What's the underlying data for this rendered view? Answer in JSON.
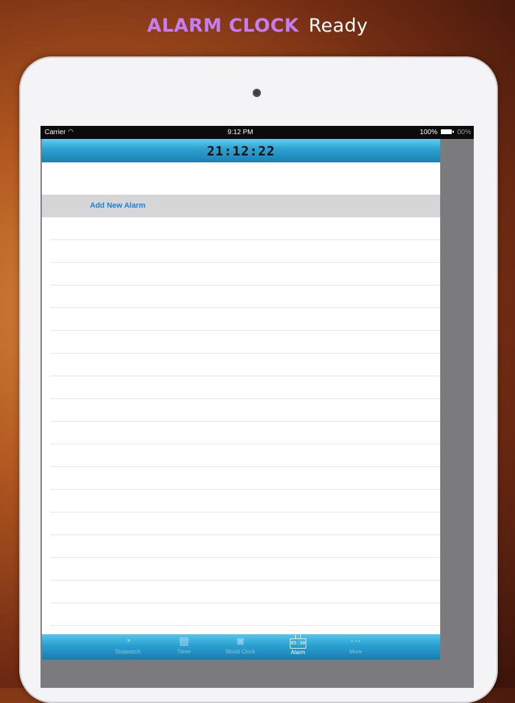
{
  "headline": {
    "brand": "ALARM CLOCK",
    "word": "Ready"
  },
  "status_bar": {
    "carrier": "Carrier",
    "time": "9:12 PM",
    "battery": "100%",
    "battery_cut": "00%"
  },
  "clock": {
    "time": "21:12:22"
  },
  "alarm_list": {
    "add_label": "Add New Alarm"
  },
  "tabs": [
    {
      "label": "Stopwatch",
      "icon": "stopwatch-icon",
      "active": false
    },
    {
      "label": "Timer",
      "icon": "timer-icon",
      "active": false
    },
    {
      "label": "World Clock",
      "icon": "globe-icon",
      "active": false
    },
    {
      "label": "Alarm",
      "icon": "alarm-tv-icon",
      "icon_text": "05:30",
      "active": true
    },
    {
      "label": "More",
      "icon": "more-icon",
      "active": false
    }
  ],
  "colors": {
    "tab_gradient": "#2aa0d0",
    "link": "#1d7fd6",
    "brand": "#c67cf2"
  }
}
